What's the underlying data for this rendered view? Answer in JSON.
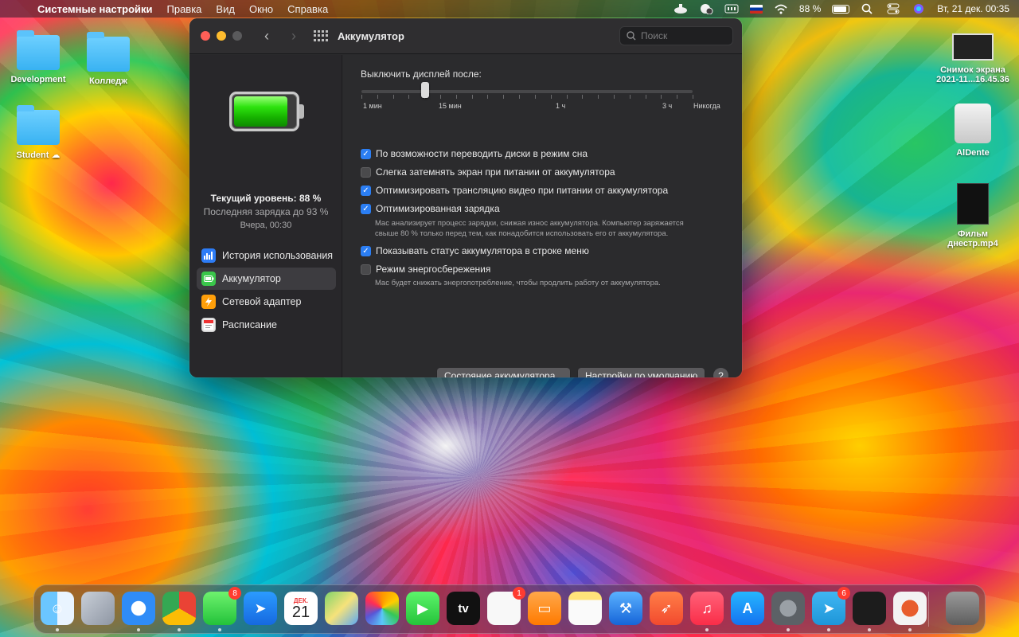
{
  "menubar": {
    "app_name": "Системные настройки",
    "menus": [
      "Правка",
      "Вид",
      "Окно",
      "Справка"
    ],
    "battery_percent": "88 %",
    "datetime": "Вт, 21 дек.  00:35"
  },
  "desktop": {
    "items": [
      {
        "label": "Development"
      },
      {
        "label": "Колледж"
      },
      {
        "label": "Student"
      },
      {
        "label_line1": "Снимок экрана",
        "label_line2": "2021-11...16.45.36"
      },
      {
        "label": "AlDente"
      },
      {
        "label_line1": "Фильм",
        "label_line2": "днестр.mp4"
      }
    ]
  },
  "window": {
    "title": "Аккумулятор",
    "search_placeholder": "Поиск"
  },
  "sidebar": {
    "battery_level_fraction": 0.88,
    "current_level": "Текущий уровень: 88 %",
    "last_charge": "Последняя зарядка до 93 %",
    "last_charge_time": "Вчера, 00:30",
    "items": [
      {
        "label": "История использования",
        "icon": "chart-icon"
      },
      {
        "label": "Аккумулятор",
        "icon": "battery-icon",
        "active": true
      },
      {
        "label": "Сетевой адаптер",
        "icon": "lightning-icon"
      },
      {
        "label": "Расписание",
        "icon": "calendar-icon"
      }
    ]
  },
  "settings": {
    "slider_label": "Выключить дисплей после:",
    "slider_value": "15 мин",
    "slider_ticks": [
      "1 мин",
      "15 мин",
      "1 ч",
      "3 ч",
      "Никогда"
    ],
    "options": [
      {
        "label": "По возможности переводить диски в режим сна",
        "checked": true
      },
      {
        "label": "Слегка затемнять экран при питании от аккумулятора",
        "checked": false
      },
      {
        "label": "Оптимизировать трансляцию видео при питании от аккумулятора",
        "checked": true
      },
      {
        "label": "Оптимизированная зарядка",
        "checked": true,
        "description_line1": "Mac анализирует процесс зарядки, снижая износ аккумулятора. Компьютер заряжается",
        "description_line2": "свыше 80 % только перед тем, как понадобится использовать его от аккумулятора."
      },
      {
        "label": "Показывать статус аккумулятора в строке меню",
        "checked": true
      },
      {
        "label": "Режим энергосбережения",
        "checked": false,
        "description_line1": "Mac будет снижать энергопотребление, чтобы продлить работу от аккумулятора."
      }
    ],
    "battery_status_button": "Состояние аккумулятора...",
    "defaults_button": "Настройки по умолчанию",
    "help_label": "?"
  },
  "dock": {
    "apps": [
      {
        "name": "finder-icon"
      },
      {
        "name": "launchpad-icon"
      },
      {
        "name": "safari-icon"
      },
      {
        "name": "chrome-icon"
      },
      {
        "name": "messages-icon",
        "badge": "8"
      },
      {
        "name": "spark-icon"
      },
      {
        "name": "calendar-icon",
        "month": "ДЕК.",
        "day": "21"
      },
      {
        "name": "maps-icon"
      },
      {
        "name": "photos-icon"
      },
      {
        "name": "facetime-icon"
      },
      {
        "name": "apple-tv-icon",
        "label": "tv"
      },
      {
        "name": "reminders-icon",
        "badge": "1"
      },
      {
        "name": "books-icon"
      },
      {
        "name": "notes-icon"
      },
      {
        "name": "xcode-icon"
      },
      {
        "name": "swift-playgrounds-icon"
      },
      {
        "name": "music-icon"
      },
      {
        "name": "app-store-icon"
      },
      {
        "name": "system-preferences-icon"
      },
      {
        "name": "telegram-icon",
        "badge": "6"
      },
      {
        "name": "activity-monitor-icon"
      },
      {
        "name": "aldente-icon"
      },
      {
        "name": "trash-icon"
      }
    ]
  }
}
